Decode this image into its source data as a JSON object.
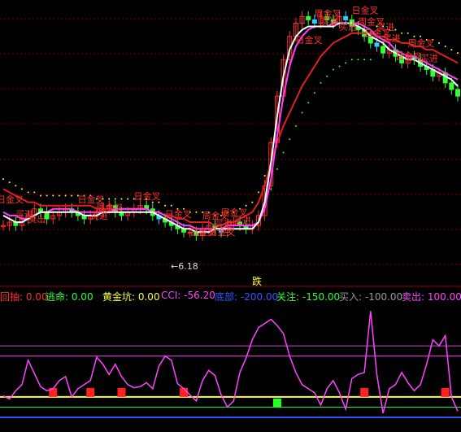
{
  "chart_data": [
    {
      "type": "line",
      "panel": "main-price",
      "overlays": [
        "close",
        "ma-white",
        "ma-magenta",
        "ma-red",
        "sar-yellow"
      ],
      "annotations_text": {
        "jinchu": "跌",
        "low_value": "6.18",
        "labels": [
          "日金叉",
          "买进",
          "卖出",
          "日金叉",
          "周金叉",
          "买进",
          "日金叉",
          "日金叉",
          "日金叉",
          "周金叉",
          "买进",
          "日金叉",
          "周金叉",
          "买进",
          "日金叉",
          "周金叉",
          "买进",
          "买进",
          "日金叉",
          "周金叉",
          "日金叉",
          "买进",
          "买进",
          "日金叉",
          "周金叉",
          "买进"
        ]
      },
      "close": [
        33,
        34,
        33,
        35,
        36,
        38,
        37,
        35,
        36,
        37,
        38,
        37,
        36,
        35,
        36,
        37,
        38,
        39,
        37,
        36,
        37,
        38,
        39,
        38,
        36,
        35,
        34,
        33,
        32,
        31,
        31,
        30,
        32,
        33,
        32,
        31,
        33,
        34,
        33,
        32,
        33,
        36,
        45,
        58,
        72,
        83,
        90,
        94,
        96,
        95,
        94,
        96,
        95,
        94,
        96,
        95,
        93,
        92,
        90,
        88,
        87,
        85,
        86,
        84,
        82,
        84,
        83,
        81,
        80,
        78,
        79,
        76,
        74,
        72
      ],
      "ma_white": [
        36,
        35,
        34,
        34,
        35,
        36,
        37,
        37,
        37,
        37,
        37,
        37,
        37,
        36,
        36,
        36,
        37,
        37,
        37,
        37,
        37,
        37,
        37,
        37,
        37,
        36,
        35,
        34,
        33,
        32,
        32,
        31,
        31,
        31,
        32,
        32,
        32,
        32,
        32,
        32,
        32,
        34,
        40,
        52,
        66,
        78,
        86,
        90,
        92,
        93,
        93,
        93,
        93,
        93,
        94,
        94,
        94,
        93,
        92,
        90,
        89,
        88,
        86,
        85,
        84,
        83,
        83,
        82,
        81,
        80,
        79,
        78,
        77,
        75
      ],
      "ma_magenta": [
        37,
        36,
        36,
        35,
        35,
        36,
        37,
        37,
        38,
        38,
        38,
        38,
        37,
        37,
        37,
        37,
        37,
        37,
        38,
        38,
        38,
        38,
        38,
        38,
        37,
        37,
        36,
        35,
        34,
        33,
        33,
        32,
        32,
        32,
        32,
        32,
        33,
        33,
        33,
        33,
        33,
        34,
        38,
        47,
        60,
        72,
        81,
        87,
        90,
        92,
        93,
        93,
        93,
        94,
        94,
        94,
        94,
        94,
        93,
        92,
        90,
        89,
        88,
        86,
        85,
        84,
        84,
        83,
        82,
        81,
        80,
        79,
        78,
        77
      ],
      "ma_red": [
        44,
        43,
        42,
        41,
        40,
        40,
        39,
        39,
        39,
        39,
        39,
        39,
        39,
        39,
        39,
        38,
        38,
        38,
        38,
        38,
        38,
        38,
        38,
        38,
        37,
        37,
        36,
        36,
        35,
        35,
        34,
        34,
        34,
        34,
        33,
        33,
        34,
        34,
        35,
        36,
        37,
        40,
        45,
        52,
        58,
        63,
        67,
        71,
        75,
        78,
        81,
        84,
        86,
        88,
        89,
        90,
        91,
        91,
        91,
        91,
        90,
        90,
        89,
        89,
        88,
        88,
        87,
        87,
        86,
        86,
        85,
        84,
        83,
        82
      ],
      "ylim": [
        22,
        100
      ],
      "grid": "dashed-red-horizontal"
    },
    {
      "type": "line",
      "panel": "oscillator",
      "indicator_bar": {
        "items": [
          {
            "label": "回抽:",
            "value": "0.00",
            "color": "#ff3030"
          },
          {
            "label": "逃命:",
            "value": "0.00",
            "color": "#33ff33"
          },
          {
            "label": "黄金坑:",
            "value": "0.00",
            "color": "#ffff33"
          },
          {
            "label": "CCI:",
            "value": "-56.20",
            "color": "#ff44ff"
          },
          {
            "label": "底部:",
            "value": "-200.00",
            "color": "#3355ff"
          },
          {
            "label": "关注:",
            "value": "-150.00",
            "color": "#33ff33"
          },
          {
            "label": "买入:",
            "value": "-100.00",
            "color": "#9a9a9a"
          },
          {
            "label": "卖出:",
            "value": "100.00",
            "color": "#ff44ff"
          }
        ]
      },
      "levels": {
        "top": 150,
        "sell": 100,
        "buy": -100,
        "focus": -150,
        "bottom": -200
      },
      "cci": [
        -95,
        -110,
        -70,
        -40,
        80,
        15,
        -50,
        -70,
        -60,
        -20,
        0,
        -100,
        -60,
        -40,
        -20,
        95,
        60,
        10,
        60,
        0,
        -40,
        -55,
        -50,
        -30,
        -60,
        50,
        100,
        80,
        -35,
        -60,
        -90,
        -120,
        -20,
        30,
        5,
        -90,
        -150,
        -120,
        20,
        90,
        180,
        240,
        260,
        280,
        250,
        210,
        100,
        20,
        -40,
        -60,
        -80,
        -140,
        -60,
        -20,
        -80,
        -160,
        -10,
        10,
        20,
        320,
        10,
        -180,
        -60,
        -40,
        20,
        -30,
        -70,
        -40,
        60,
        180,
        150,
        200,
        -100,
        -170
      ],
      "signals_red": [
        8,
        14,
        19,
        29,
        58,
        71
      ],
      "signals_green": [
        44
      ],
      "ylim": [
        -260,
        330
      ]
    }
  ]
}
